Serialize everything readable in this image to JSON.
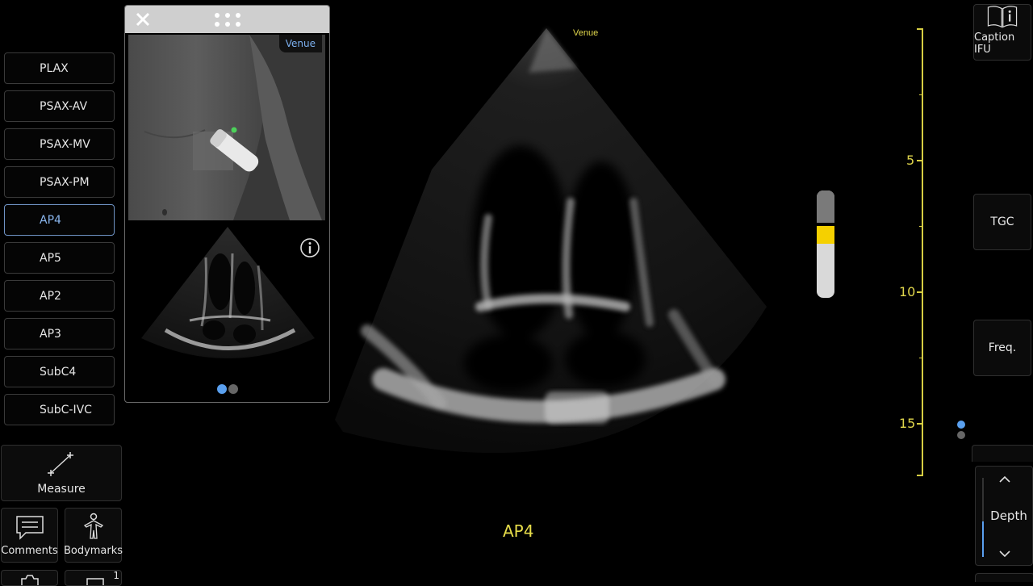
{
  "views": [
    "PLAX",
    "PSAX-AV",
    "PSAX-MV",
    "PSAX-PM",
    "AP4",
    "AP5",
    "AP2",
    "AP3",
    "SubC4",
    "SubC-IVC"
  ],
  "active_view": "AP4",
  "tools": {
    "measure_label": "Measure",
    "comments_label": "Comments",
    "bodymarks_label": "Bodymarks",
    "badge_count": "1"
  },
  "guide_panel": {
    "venue_label": "Venue",
    "close_icon": "close-icon",
    "drag_icon": "grip-dots-icon",
    "info_icon": "info-icon"
  },
  "image": {
    "venue_label": "Venue",
    "view_label": "AP4"
  },
  "depth_scale": {
    "ticks": [
      "5",
      "10",
      "15"
    ]
  },
  "right_controls": {
    "caption_ifu_label": "Caption IFU",
    "tgc_label": "TGC",
    "freq_label": "Freq.",
    "depth_label": "Depth"
  },
  "colors": {
    "accent_blue": "#5aa0ef",
    "scale_yellow": "#e0d64c",
    "gain_yellow": "#f5d000"
  }
}
